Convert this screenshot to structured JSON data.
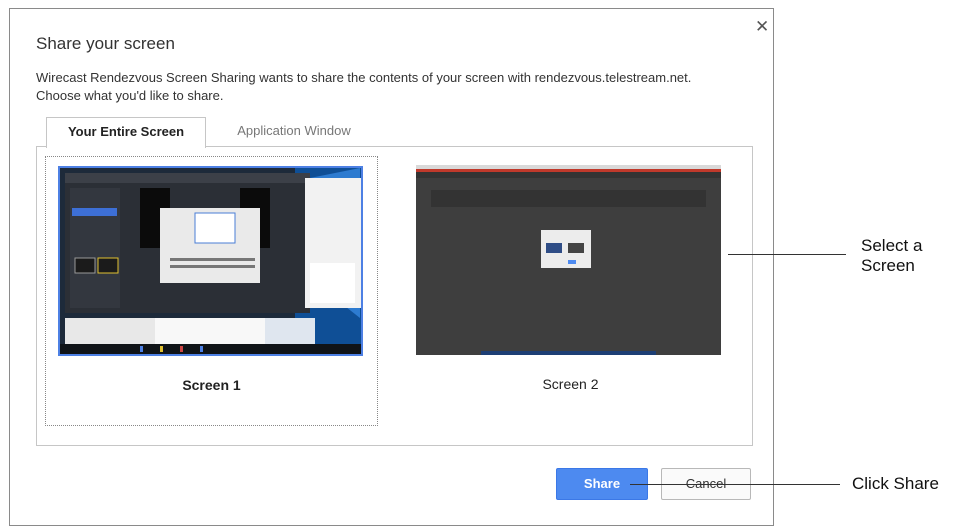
{
  "dialog": {
    "title": "Share your screen",
    "message": "Wirecast Rendezvous Screen Sharing wants to share the contents of your screen with rendezvous.telestream.net. Choose what you'd like to share.",
    "close_icon": "close-icon"
  },
  "tabs": [
    {
      "label": "Your Entire Screen",
      "active": true
    },
    {
      "label": "Application Window",
      "active": false
    }
  ],
  "screens": [
    {
      "label": "Screen 1",
      "selected": true
    },
    {
      "label": "Screen 2",
      "selected": false
    }
  ],
  "buttons": {
    "share_label": "Share",
    "cancel_label": "Cancel"
  },
  "callouts": {
    "select": "Select a\nScreen",
    "share": "Click Share"
  },
  "colors": {
    "accent": "#4d8af0",
    "selection_border": "#4d80e4"
  }
}
